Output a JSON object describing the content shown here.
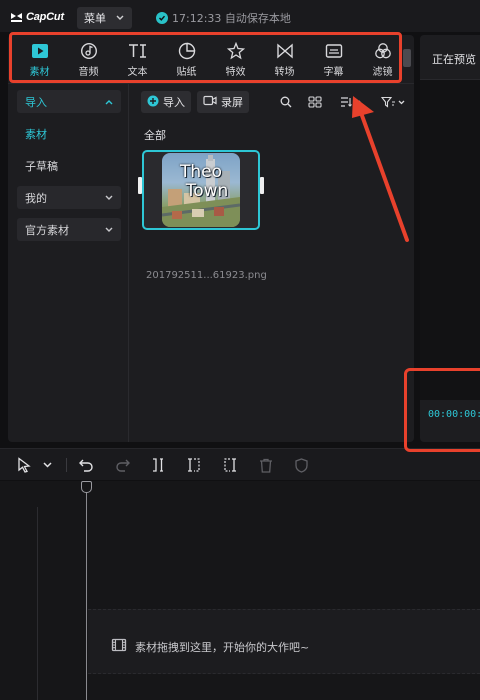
{
  "app": {
    "logo_text": "CapCut",
    "menu_label": "菜单",
    "autosave_text": "17:12:33 自动保存本地"
  },
  "tabs": [
    {
      "label": "素材",
      "icon": "media-icon",
      "active": true
    },
    {
      "label": "音频",
      "icon": "audio-icon",
      "active": false
    },
    {
      "label": "文本",
      "icon": "text-icon",
      "active": false
    },
    {
      "label": "贴纸",
      "icon": "sticker-icon",
      "active": false
    },
    {
      "label": "特效",
      "icon": "effects-icon",
      "active": false
    },
    {
      "label": "转场",
      "icon": "transition-icon",
      "active": false
    },
    {
      "label": "字幕",
      "icon": "captions-icon",
      "active": false
    },
    {
      "label": "滤镜",
      "icon": "filter-icon",
      "active": false
    }
  ],
  "sidebar": {
    "items": [
      {
        "label": "导入",
        "style": "top"
      },
      {
        "label": "素材",
        "style": "sel"
      },
      {
        "label": "子草稿",
        "style": "plain"
      },
      {
        "label": "我的",
        "style": "box"
      },
      {
        "label": "官方素材",
        "style": "box"
      }
    ]
  },
  "media": {
    "import_label": "导入",
    "record_label": "录屏",
    "section_label": "全部",
    "thumb_line1": "Theo",
    "thumb_line2": "Town",
    "file_name": "201792511...61923.png"
  },
  "preview": {
    "title": "正在预览",
    "timecode": "00:00:00:"
  },
  "timeline": {
    "drop_hint": "素材拖拽到这里，开始你的大作吧~"
  },
  "colors": {
    "accent": "#2ec7d6",
    "annotation": "#e8412c",
    "background": "#101012",
    "panel": "#1d1d20"
  }
}
